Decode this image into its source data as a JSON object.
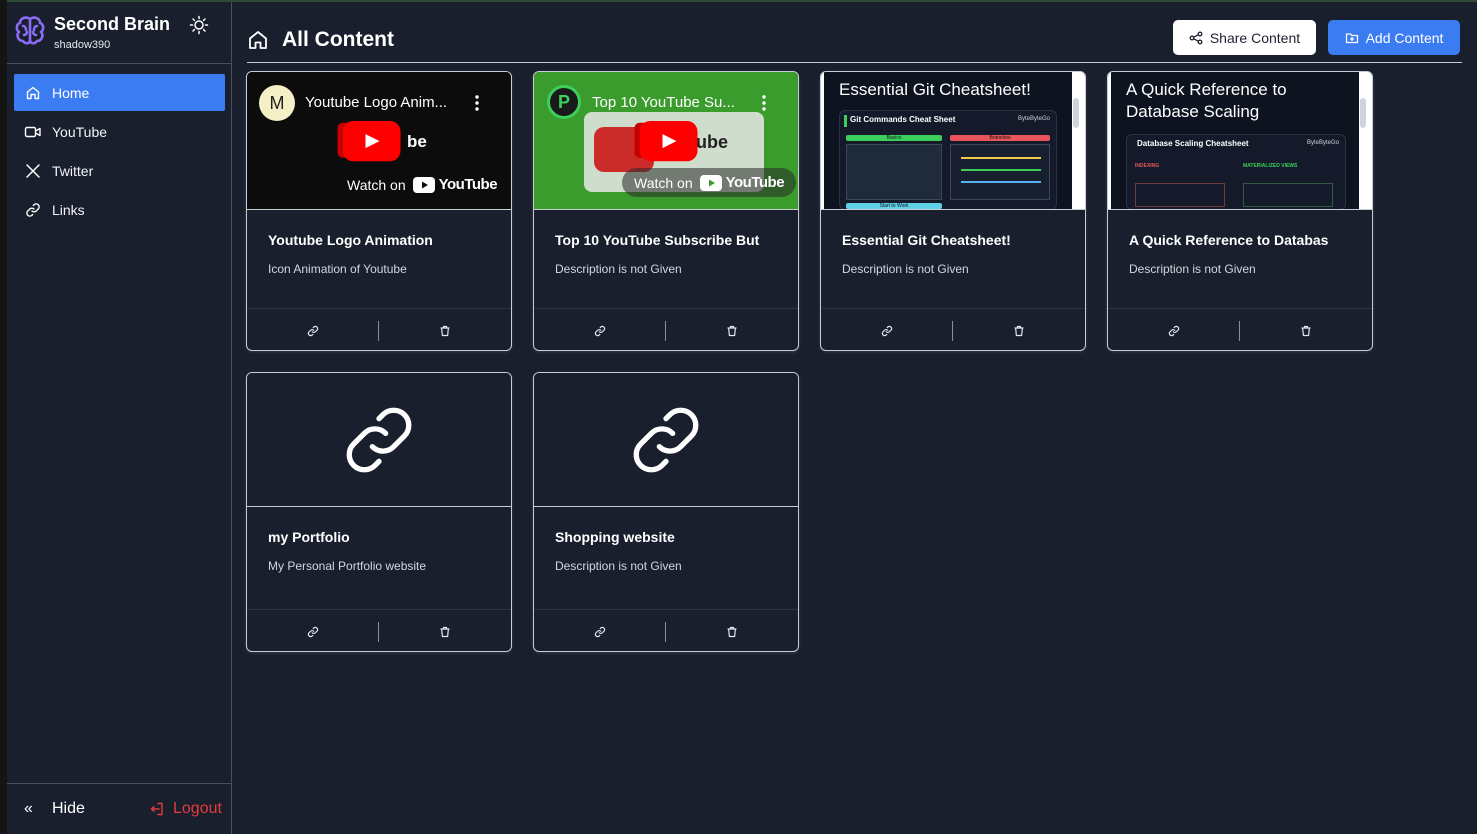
{
  "app": {
    "name": "Second Brain",
    "username": "shadow390"
  },
  "sidebar": {
    "items": [
      {
        "label": "Home",
        "icon": "home-icon",
        "active": true
      },
      {
        "label": "YouTube",
        "icon": "video-icon",
        "active": false
      },
      {
        "label": "Twitter",
        "icon": "x-icon",
        "active": false
      },
      {
        "label": "Links",
        "icon": "link-icon",
        "active": false
      }
    ],
    "hide_label": "Hide",
    "logout_label": "Logout"
  },
  "header": {
    "title": "All Content",
    "share_label": "Share Content",
    "add_label": "Add Content"
  },
  "colors": {
    "background": "#1a1f2e",
    "accent": "#3b7cf2",
    "danger": "#e53b3b",
    "youtube_red": "#ff0000"
  },
  "cards": [
    {
      "type": "youtube",
      "title": "Youtube Logo Animation",
      "description": "Icon Animation of Youtube",
      "thumb": {
        "video_title": "Youtube Logo Anim...",
        "avatar": "M",
        "watch_on": "Watch on",
        "brand": "YouTube",
        "fragment": "be"
      }
    },
    {
      "type": "youtube",
      "title": "Top 10 YouTube Subscribe But",
      "description": "Description is not Given",
      "thumb": {
        "video_title": "Top 10 YouTube Su...",
        "avatar": "P",
        "watch_on": "Watch on",
        "brand": "YouTube",
        "fragment": "ube"
      }
    },
    {
      "type": "document",
      "title": "Essential Git Cheatsheet!",
      "description": "Description is not Given",
      "thumb": {
        "heading": "Essential Git Cheatsheet!",
        "panel_title": "Git  Commands Cheat Sheet",
        "brand": "ByteByteGo",
        "sections": [
          "Basics",
          "Branches",
          "Start to Work"
        ]
      }
    },
    {
      "type": "document",
      "title": "A Quick Reference to Databas",
      "description": "Description is not Given",
      "thumb": {
        "heading_line1": "A Quick Reference to",
        "heading_line2": "Database Scaling",
        "panel_title": "Database Scaling Cheatsheet",
        "brand": "ByteByteGo",
        "sections": [
          "INDEXING",
          "MATERIALIZED VIEWS"
        ]
      }
    },
    {
      "type": "link",
      "title": "my Portfolio",
      "description": "My Personal Portfolio website"
    },
    {
      "type": "link",
      "title": "Shopping website",
      "description": "Description is not Given"
    }
  ]
}
